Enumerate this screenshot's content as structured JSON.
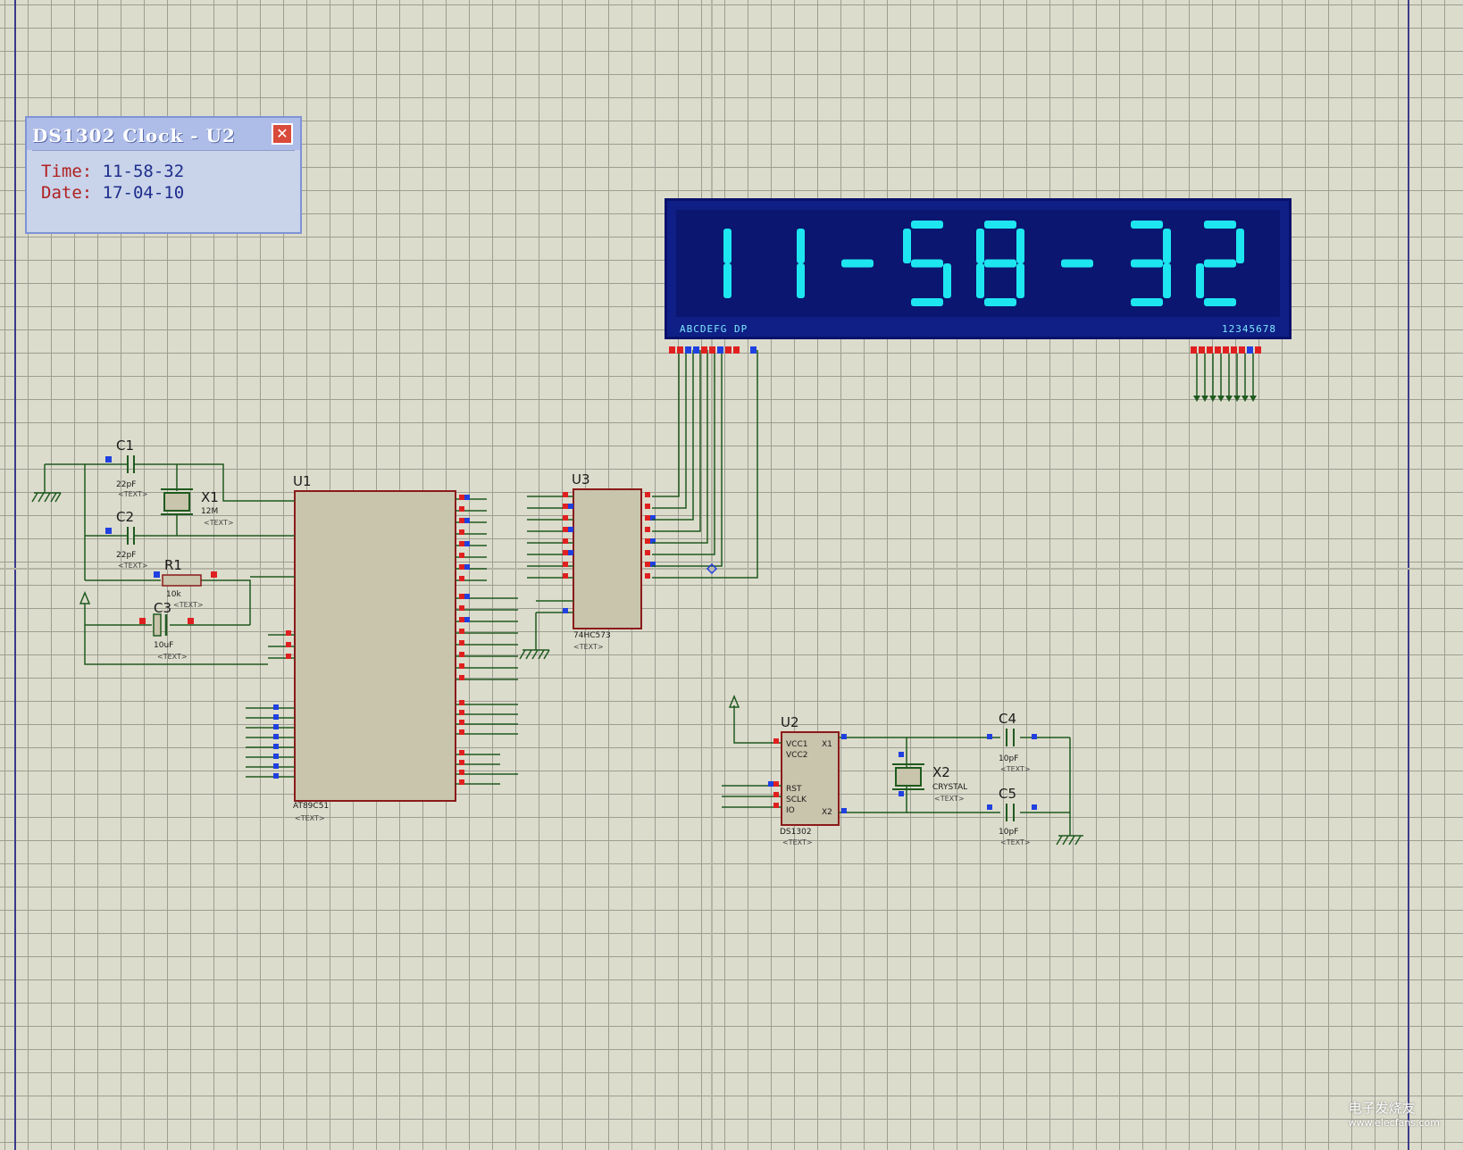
{
  "popup": {
    "title": "DS1302 Clock - U2",
    "close_glyph": "✕",
    "time_label": "Time:",
    "time_value": "11-58-32",
    "date_label": "Date:",
    "date_value": "17-04-10"
  },
  "lcd": {
    "display_text": "11-58-32",
    "segment_pins_label": "ABCDEFG DP",
    "digit_pins_label": "12345678",
    "digit_color": "#1ee6f0",
    "background_color": "#0f1f85"
  },
  "components": {
    "u1": {
      "ref": "U1",
      "part": "AT89C51"
    },
    "u2": {
      "ref": "U2",
      "part": "DS1302",
      "pins": [
        "VCC1",
        "VCC2",
        "RST",
        "SCLK",
        "IO",
        "X1",
        "X2"
      ]
    },
    "u3": {
      "ref": "U3",
      "part": "74HC573"
    },
    "c1": {
      "ref": "C1",
      "value": "22pF"
    },
    "c2": {
      "ref": "C2",
      "value": "22pF"
    },
    "c3": {
      "ref": "C3",
      "value": "10uF"
    },
    "c4": {
      "ref": "C4",
      "value": "10pF"
    },
    "c5": {
      "ref": "C5",
      "value": "10pF"
    },
    "x1": {
      "ref": "X1",
      "value": "12M"
    },
    "x2": {
      "ref": "X2",
      "value": "CRYSTAL"
    },
    "r1": {
      "ref": "R1",
      "value": "10k"
    },
    "text_placeholder": "<TEXT>"
  },
  "watermark": {
    "main": "电子发烧友",
    "sub": "www.elecfans.com"
  },
  "colors": {
    "canvas": "#dcdccc",
    "grid": "#9d9d92",
    "wire": "#1f5a1f",
    "chip_fill": "#c9c4ac",
    "chip_border": "#8a1a1a",
    "pin_red": "#e02020",
    "pin_blue": "#2040e0"
  }
}
